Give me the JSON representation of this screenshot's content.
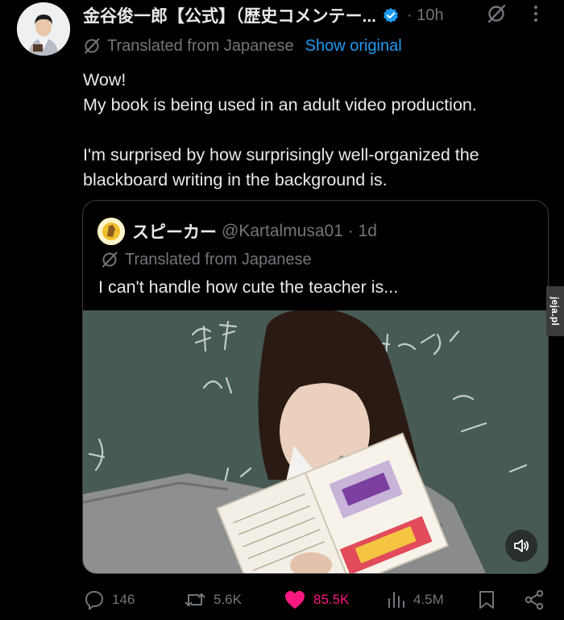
{
  "author": {
    "name": "金谷俊一郎【公式】（歴史コメンテー...",
    "time": "· 10h",
    "verified": true,
    "avatar_icon": "person-in-kimono-avatar"
  },
  "translation": {
    "label": "Translated from Japanese",
    "show_original": "Show original"
  },
  "post": {
    "lines": [
      "Wow!",
      "My book is being used in an adult video production.",
      "I'm surprised by how surprisingly well-organized the blackboard writing in the background is."
    ]
  },
  "quote": {
    "name": "スピーカー",
    "handle": "@Kartalmusa01 · 1d",
    "translated_label": "Translated from Japanese",
    "text": "I can't handle how cute the teacher is...",
    "media": {
      "description_icon": "video-thumbnail",
      "volume_icon": "speaker-muted-icon"
    }
  },
  "actions": {
    "replies": "146",
    "reposts": "5.6K",
    "likes": "85.5K",
    "views": "4.5M"
  },
  "watermark": "jeja.pl",
  "colors": {
    "background": "#000000",
    "text": "#e7e9ea",
    "muted": "#71767b",
    "link": "#1d9bf0",
    "like": "#f91880",
    "verified": "#1d9bf0"
  }
}
